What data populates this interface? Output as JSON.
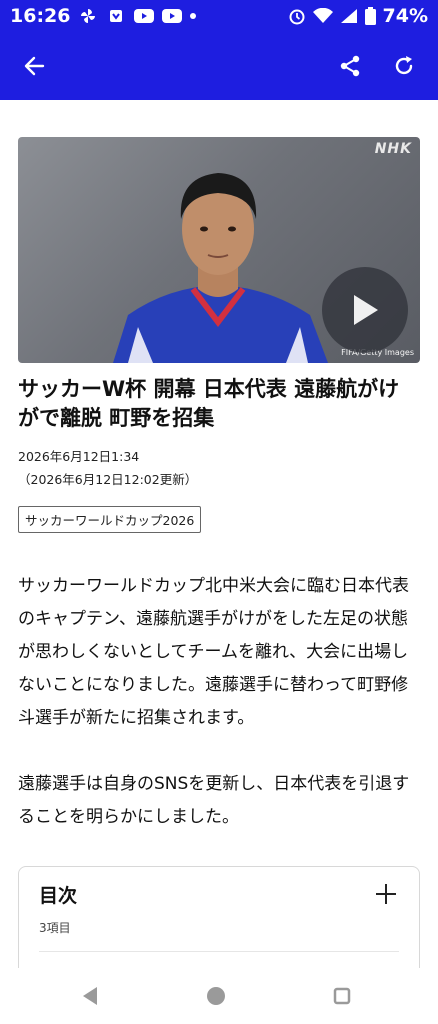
{
  "status_bar": {
    "time": "16:26",
    "battery": "74%",
    "left_icons": [
      "pinwheel-icon",
      "shield-icon",
      "youtube-icon",
      "youtube-icon",
      "dot-icon"
    ],
    "right_icons": [
      "alarm-icon",
      "wifi-icon",
      "signal-icon",
      "battery-icon"
    ]
  },
  "app_bar": {
    "color": "#1e1ee0",
    "back_icon": "back-arrow-icon",
    "share_icon": "share-icon",
    "refresh_icon": "refresh-icon"
  },
  "video": {
    "logo": "NHK",
    "credit": "FIFA/Getty Images",
    "play_icon": "play-icon"
  },
  "article": {
    "headline": "サッカーW杯 開幕 日本代表 遠藤航がけがで離脱 町野を招集",
    "published": "2026年6月12日1:34",
    "updated": "（2026年6月12日12:02更新）",
    "tag": "サッカーワールドカップ2026",
    "paragraphs": [
      "サッカーワールドカップ北中米大会に臨む日本代表のキャプテン、遠藤航選手がけがをした左足の状態が思わしくないとしてチームを離れ、大会に出場しないことになりました。遠藤選手に替わって町野修斗選手が新たに招集されます。",
      "遠藤選手は自身のSNSを更新し、日本代表を引退することを明らかにしました。"
    ]
  },
  "toc": {
    "title": "目次",
    "count": "3項目",
    "expand_icon": "plus-icon"
  },
  "nav_bar": {
    "buttons": [
      "back-triangle-icon",
      "home-circle-icon",
      "recents-icon"
    ]
  }
}
